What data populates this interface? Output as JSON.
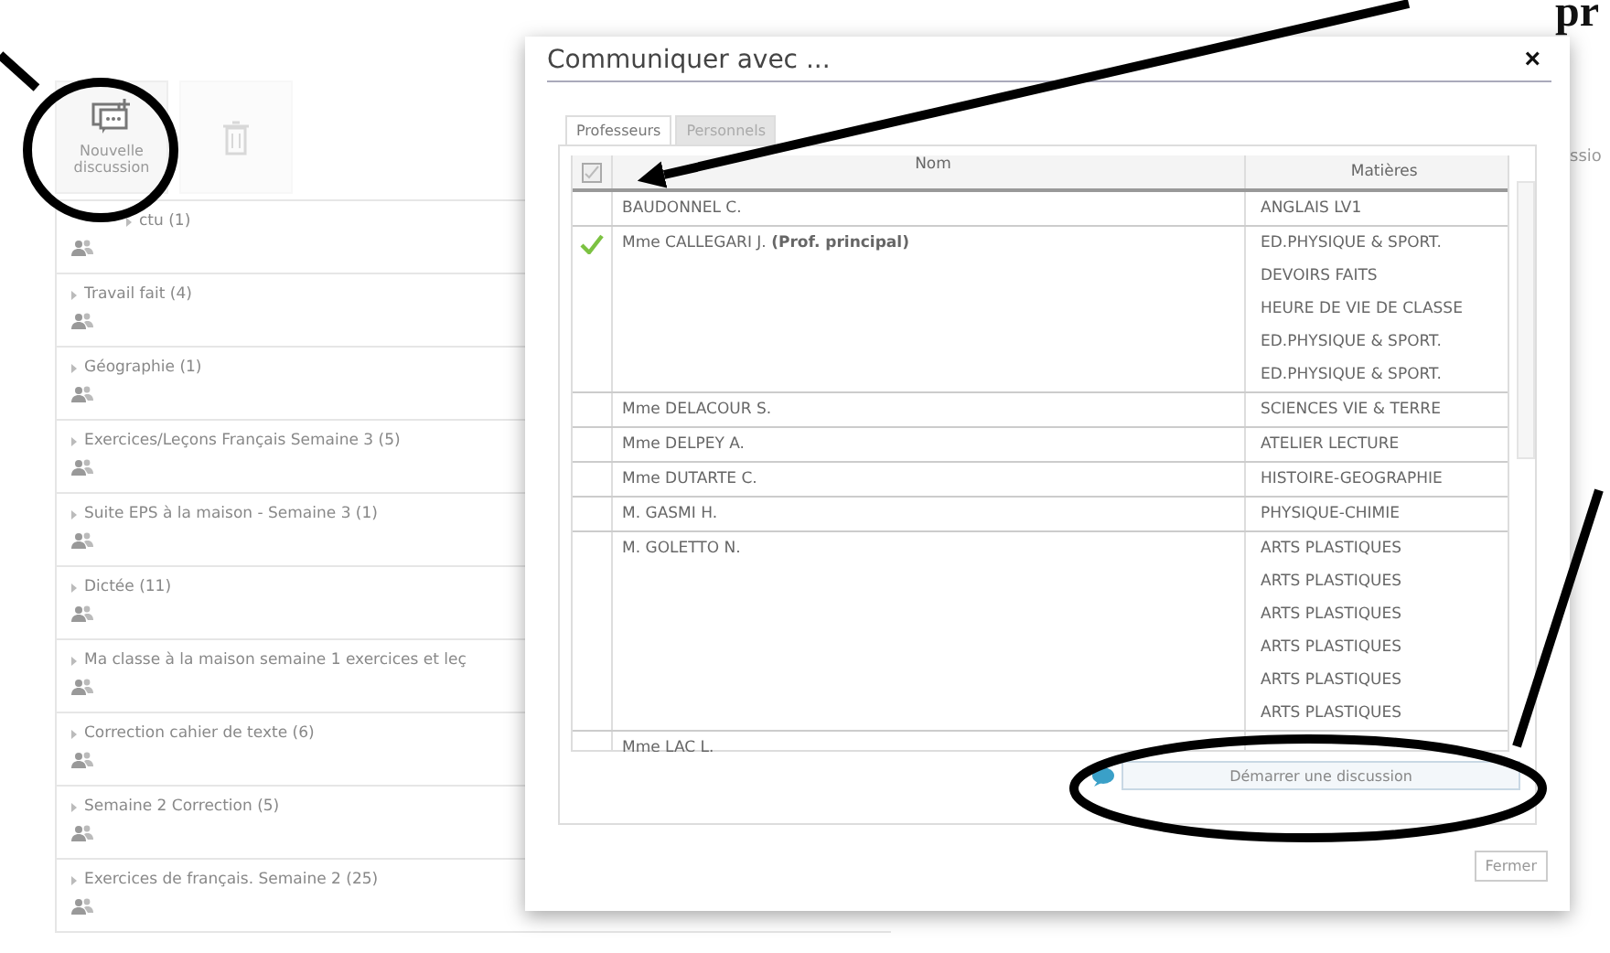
{
  "toolbar": {
    "buttons": [
      {
        "kind": "new",
        "label": "Nouvelle discussion",
        "disabled": false
      },
      {
        "kind": "trash",
        "disabled": true
      }
    ]
  },
  "discussions": [
    {
      "title": "ctu (1)"
    },
    {
      "title": "Travail fait (4)"
    },
    {
      "title": "Géographie (1)"
    },
    {
      "title": "Exercices/Leçons Français Semaine 3 (5)"
    },
    {
      "title": "Suite EPS à la maison - Semaine 3 (1)"
    },
    {
      "title": "Dictée (11)"
    },
    {
      "title": "Ma classe à la maison semaine 1 exercices et leç"
    },
    {
      "title": "Correction cahier de texte (6)"
    },
    {
      "title": "Semaine 2 Correction (5)"
    },
    {
      "title": "Exercices de français. Semaine 2 (25)"
    }
  ],
  "side_text": "ssio",
  "dialog": {
    "title": "Communiquer avec ...",
    "close": "×",
    "tabs": [
      {
        "label": "Professeurs",
        "selected": true
      },
      {
        "label": "Personnels",
        "selected": false
      }
    ],
    "columns": [
      "Nom",
      "Matières"
    ],
    "rows": [
      {
        "name": "BAUDONNEL C.",
        "checked": false,
        "subjects": [
          "ANGLAIS LV1"
        ]
      },
      {
        "name": "Mme CALLEGARI J. **(Prof. principal)**",
        "checked": true,
        "subjects": [
          "ED.PHYSIQUE & SPORT.",
          "DEVOIRS FAITS",
          "HEURE DE VIE DE CLASSE",
          "ED.PHYSIQUE & SPORT.",
          "ED.PHYSIQUE & SPORT."
        ]
      },
      {
        "name": "Mme DELACOUR S.",
        "checked": false,
        "subjects": [
          "SCIENCES VIE & TERRE"
        ]
      },
      {
        "name": "Mme DELPEY A.",
        "checked": false,
        "subjects": [
          "ATELIER LECTURE"
        ]
      },
      {
        "name": "Mme DUTARTE C.",
        "checked": false,
        "subjects": [
          "HISTOIRE-GEOGRAPHIE"
        ]
      },
      {
        "name": "M. GASMI H.",
        "checked": false,
        "subjects": [
          "PHYSIQUE-CHIMIE"
        ]
      },
      {
        "name": "M. GOLETTO N.",
        "checked": false,
        "subjects": [
          "ARTS PLASTIQUES",
          "ARTS PLASTIQUES",
          "ARTS PLASTIQUES",
          "ARTS PLASTIQUES",
          "ARTS PLASTIQUES",
          "ARTS PLASTIQUES"
        ]
      },
      {
        "name": "Mme LAC L.",
        "checked": false,
        "subjects": []
      }
    ],
    "start_button": "Démarrer une discussion",
    "close_button": "Fermer"
  },
  "annotation_text": "pr"
}
